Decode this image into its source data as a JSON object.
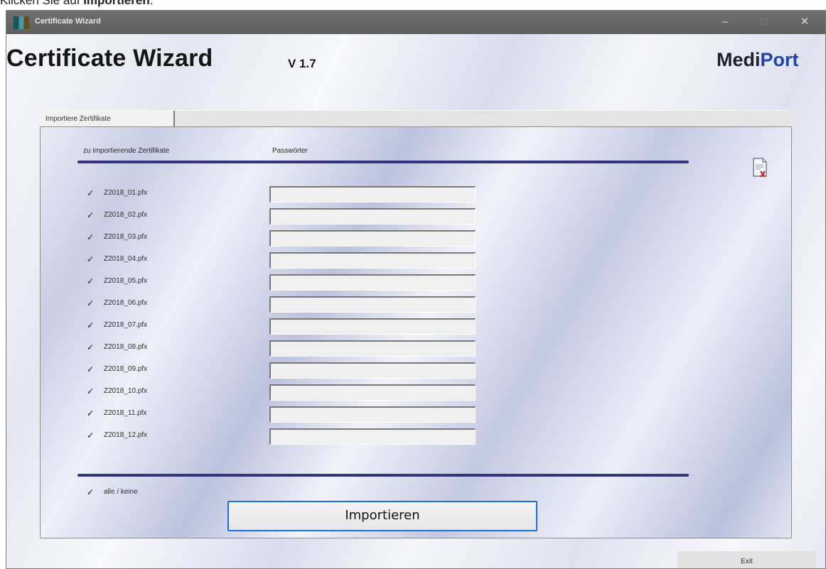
{
  "instruction": {
    "prefix": "Klicken Sie auf ",
    "bold": "Importieren",
    "suffix": "."
  },
  "window": {
    "title": "Certificate Wizard",
    "controls": {
      "minimize": "–",
      "maximize": "□",
      "close": "✕"
    }
  },
  "header": {
    "app_title": "Certificate Wizard",
    "version": "V 1.7",
    "brand_part1": "Medi",
    "brand_part2": "Port"
  },
  "tab": {
    "label": "Importiere Zertifikate"
  },
  "list": {
    "col_certificates": "zu importierende Zertifikate",
    "col_passwords": "Passwörter",
    "items": [
      {
        "file": "Z2018_01.pfx",
        "checked": true,
        "password": ""
      },
      {
        "file": "Z2018_02.pfx",
        "checked": true,
        "password": ""
      },
      {
        "file": "Z2018_03.pfx",
        "checked": true,
        "password": ""
      },
      {
        "file": "Z2018_04.pfx",
        "checked": true,
        "password": ""
      },
      {
        "file": "Z2018_05.pfx",
        "checked": true,
        "password": ""
      },
      {
        "file": "Z2018_06.pfx",
        "checked": true,
        "password": ""
      },
      {
        "file": "Z2018_07.pfx",
        "checked": true,
        "password": ""
      },
      {
        "file": "Z2018_08.pfx",
        "checked": true,
        "password": ""
      },
      {
        "file": "Z2018_09.pfx",
        "checked": true,
        "password": ""
      },
      {
        "file": "Z2018_10.pfx",
        "checked": true,
        "password": ""
      },
      {
        "file": "Z2018_11.pfx",
        "checked": true,
        "password": ""
      },
      {
        "file": "Z2018_12.pfx",
        "checked": true,
        "password": ""
      }
    ]
  },
  "footer": {
    "all_none_label": "alle / keine",
    "all_none_checked": true,
    "import_label": "Importieren",
    "exit_label": "Exit"
  },
  "icons": {
    "checkmark": "checkmark-icon",
    "document": "document-icon"
  },
  "colors": {
    "accent_rule": "#33367d",
    "brand_blue": "#1f46a6",
    "focus_border": "#1d6fd6",
    "titlebar": "#666666"
  }
}
